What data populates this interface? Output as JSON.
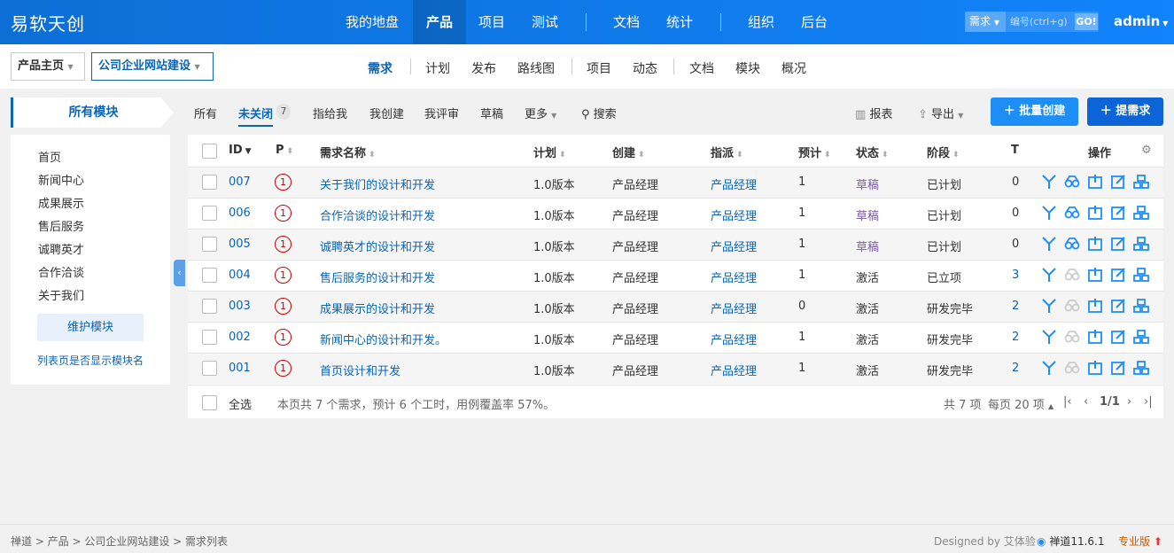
{
  "brand": "易软天创",
  "nav": {
    "items": [
      "我的地盘",
      "产品",
      "项目",
      "测试",
      "文档",
      "统计",
      "组织",
      "后台"
    ],
    "search_type": "需求",
    "search_placeholder": "编号(ctrl+g)",
    "go": "GO!",
    "user": "admin"
  },
  "breadcrumb": {
    "home": "产品主页",
    "product": "公司企业网站建设"
  },
  "subnav": [
    "需求",
    "计划",
    "发布",
    "路线图",
    "项目",
    "动态",
    "文档",
    "模块",
    "概况"
  ],
  "sidebar": {
    "title": "所有模块",
    "modules": [
      "首页",
      "新闻中心",
      "成果展示",
      "售后服务",
      "诚聘英才",
      "合作洽谈",
      "关于我们"
    ],
    "maintain": "维护模块",
    "show_module": "列表页是否显示模块名"
  },
  "filters": {
    "tabs": [
      "所有",
      "未关闭",
      "指给我",
      "我创建",
      "我评审",
      "草稿",
      "更多"
    ],
    "active_count": "7",
    "search": "搜索",
    "report": "报表",
    "export": "导出",
    "batch_create": "批量创建",
    "create": "提需求"
  },
  "table": {
    "headers": {
      "id": "ID",
      "pri": "P",
      "name": "需求名称",
      "plan": "计划",
      "creator": "创建",
      "assigned": "指派",
      "estimate": "预计",
      "status": "状态",
      "stage": "阶段",
      "t": "T",
      "actions": "操作"
    },
    "rows": [
      {
        "id": "007",
        "pri": "1",
        "name": "关于我们的设计和开发",
        "plan": "1.0版本",
        "creator": "产品经理",
        "assigned": "产品经理",
        "estimate": "1",
        "status": "草稿",
        "stage": "已计划",
        "t": "0"
      },
      {
        "id": "006",
        "pri": "1",
        "name": "合作洽谈的设计和开发",
        "plan": "1.0版本",
        "creator": "产品经理",
        "assigned": "产品经理",
        "estimate": "1",
        "status": "草稿",
        "stage": "已计划",
        "t": "0"
      },
      {
        "id": "005",
        "pri": "1",
        "name": "诚聘英才的设计和开发",
        "plan": "1.0版本",
        "creator": "产品经理",
        "assigned": "产品经理",
        "estimate": "1",
        "status": "草稿",
        "stage": "已计划",
        "t": "0"
      },
      {
        "id": "004",
        "pri": "1",
        "name": "售后服务的设计和开发",
        "plan": "1.0版本",
        "creator": "产品经理",
        "assigned": "产品经理",
        "estimate": "1",
        "status": "激活",
        "stage": "已立项",
        "t": "3"
      },
      {
        "id": "003",
        "pri": "1",
        "name": "成果展示的设计和开发",
        "plan": "1.0版本",
        "creator": "产品经理",
        "assigned": "产品经理",
        "estimate": "0",
        "status": "激活",
        "stage": "研发完毕",
        "t": "2"
      },
      {
        "id": "002",
        "pri": "1",
        "name": "新闻中心的设计和开发。",
        "plan": "1.0版本",
        "creator": "产品经理",
        "assigned": "产品经理",
        "estimate": "1",
        "status": "激活",
        "stage": "研发完毕",
        "t": "2"
      },
      {
        "id": "001",
        "pri": "1",
        "name": "首页设计和开发",
        "plan": "1.0版本",
        "creator": "产品经理",
        "assigned": "产品经理",
        "estimate": "1",
        "status": "激活",
        "stage": "研发完毕",
        "t": "2"
      }
    ],
    "select_all": "全选",
    "summary": "本页共 7 个需求，预计 6 个工时，用例覆盖率 57%。",
    "total": "共 7 项",
    "per_page": "每页 20 项",
    "page": "1/1"
  },
  "footer": {
    "breadcrumb": "禅道 > 产品 > 公司企业网站建设 > 需求列表",
    "designed_by": "Designed by 艾体验",
    "version": "禅道11.6.1",
    "edition": "专业版"
  },
  "colors": {
    "primary": "#0c64b5",
    "topbar": "#1183fb",
    "priority": "#cc0000",
    "draft": "#7a5ea8"
  }
}
